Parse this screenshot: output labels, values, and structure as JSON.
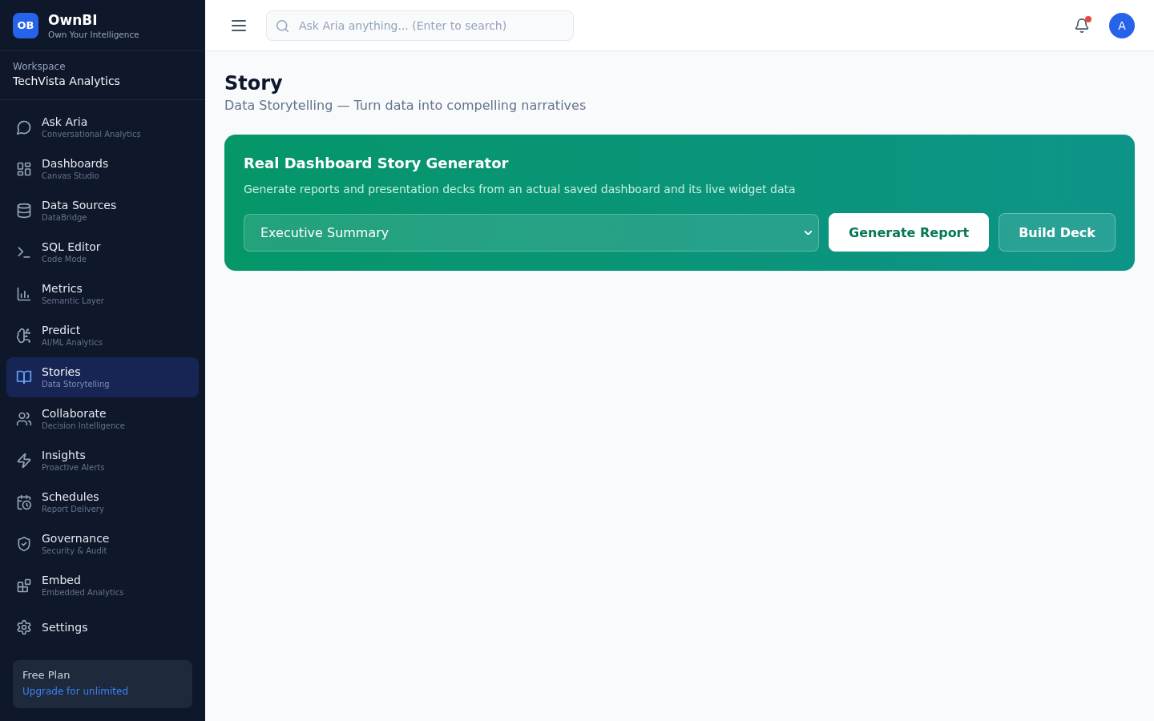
{
  "app": {
    "logo": "OB",
    "name": "OwnBI",
    "tagline": "Own Your Intelligence"
  },
  "workspace": {
    "label": "Workspace",
    "name": "TechVista Analytics"
  },
  "nav": [
    {
      "label": "Ask Aria",
      "subtitle": "Conversational Analytics",
      "selected": false
    },
    {
      "label": "Dashboards",
      "subtitle": "Canvas Studio",
      "selected": false
    },
    {
      "label": "Data Sources",
      "subtitle": "DataBridge",
      "selected": false
    },
    {
      "label": "SQL Editor",
      "subtitle": "Code Mode",
      "selected": false
    },
    {
      "label": "Metrics",
      "subtitle": "Semantic Layer",
      "selected": false
    },
    {
      "label": "Predict",
      "subtitle": "AI/ML Analytics",
      "selected": false
    },
    {
      "label": "Stories",
      "subtitle": "Data Storytelling",
      "selected": true
    },
    {
      "label": "Collaborate",
      "subtitle": "Decision Intelligence",
      "selected": false
    },
    {
      "label": "Insights",
      "subtitle": "Proactive Alerts",
      "selected": false
    },
    {
      "label": "Schedules",
      "subtitle": "Report Delivery",
      "selected": false
    },
    {
      "label": "Governance",
      "subtitle": "Security & Audit",
      "selected": false
    },
    {
      "label": "Embed",
      "subtitle": "Embedded Analytics",
      "selected": false
    },
    {
      "label": "Settings",
      "selected": false
    }
  ],
  "plan": {
    "name": "Free Plan",
    "link": "Upgrade for unlimited"
  },
  "topbar": {
    "search": {
      "placeholder": "Ask Aria anything... (Enter to search)"
    },
    "notifications": {
      "unread": true
    },
    "avatar": "A"
  },
  "page": {
    "title": "Story",
    "subtitle": "Data Storytelling — Turn data into compelling narratives"
  },
  "generator": {
    "title": "Real Dashboard Story Generator",
    "description": "Generate reports and presentation decks from an actual saved dashboard and its live widget data",
    "select": {
      "value": "Executive Summary"
    },
    "buttons": [
      {
        "label": "Generate Report",
        "kind": "primary"
      },
      {
        "label": "Build Deck",
        "kind": "secondary"
      }
    ]
  }
}
